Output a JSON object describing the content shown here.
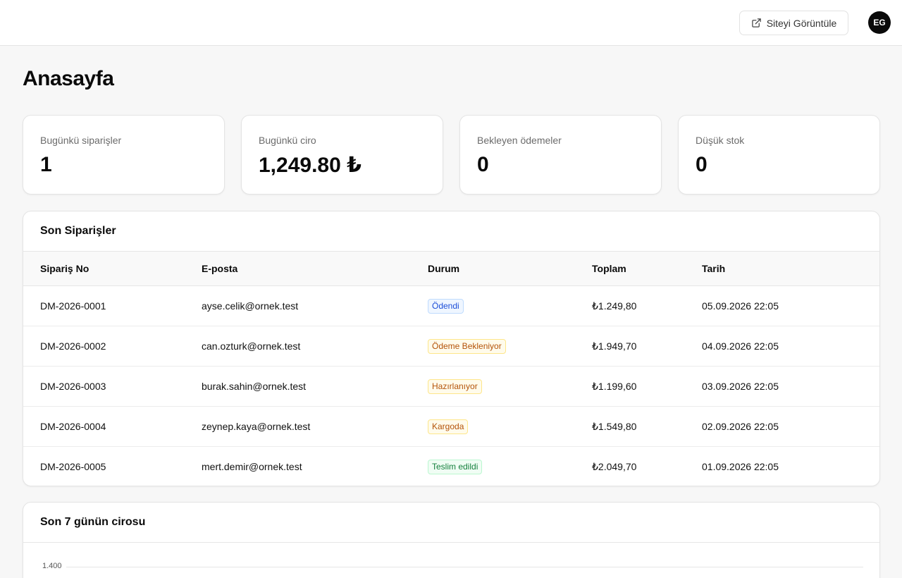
{
  "topbar": {
    "view_site_label": "Siteyi Görüntüle",
    "avatar_initials": "EG"
  },
  "page": {
    "title": "Anasayfa"
  },
  "stats": [
    {
      "label": "Bugünkü siparişler",
      "value": "1"
    },
    {
      "label": "Bugünkü ciro",
      "value": "1,249.80 ₺"
    },
    {
      "label": "Bekleyen ödemeler",
      "value": "0"
    },
    {
      "label": "Düşük stok",
      "value": "0"
    }
  ],
  "orders": {
    "title": "Son Siparişler",
    "columns": [
      "Sipariş No",
      "E-posta",
      "Durum",
      "Toplam",
      "Tarih"
    ],
    "rows": [
      {
        "no": "DM-2026-0001",
        "email": "ayse.celik@ornek.test",
        "status": "Ödendi",
        "total": "₺1.249,80",
        "date": "05.09.2026 22:05"
      },
      {
        "no": "DM-2026-0002",
        "email": "can.ozturk@ornek.test",
        "status": "Ödeme Bekleniyor",
        "total": "₺1.949,70",
        "date": "04.09.2026 22:05"
      },
      {
        "no": "DM-2026-0003",
        "email": "burak.sahin@ornek.test",
        "status": "Hazırlanıyor",
        "total": "₺1.199,60",
        "date": "03.09.2026 22:05"
      },
      {
        "no": "DM-2026-0004",
        "email": "zeynep.kaya@ornek.test",
        "status": "Kargoda",
        "total": "₺1.549,80",
        "date": "02.09.2026 22:05"
      },
      {
        "no": "DM-2026-0005",
        "email": "mert.demir@ornek.test",
        "status": "Teslim edildi",
        "total": "₺2.049,70",
        "date": "01.09.2026 22:05"
      }
    ],
    "status_colors": {
      "Ödendi": {
        "text": "#1d4ed8",
        "bg": "#eff6ff",
        "border": "#bfdbfe"
      },
      "Ödeme Bekleniyor": {
        "text": "#b45309",
        "bg": "#fffbeb",
        "border": "#fde68a"
      },
      "Hazırlanıyor": {
        "text": "#b45309",
        "bg": "#fffbeb",
        "border": "#fde68a"
      },
      "Kargoda": {
        "text": "#b45309",
        "bg": "#fffbeb",
        "border": "#fde68a"
      },
      "Teslim edildi": {
        "text": "#15803d",
        "bg": "#f0fdf4",
        "border": "#bbf7d0"
      }
    }
  },
  "revenue_chart": {
    "title": "Son 7 günün cirosu",
    "y_tick_labels": [
      "1.400"
    ]
  },
  "icons": {
    "view_site": "external-link-icon"
  }
}
